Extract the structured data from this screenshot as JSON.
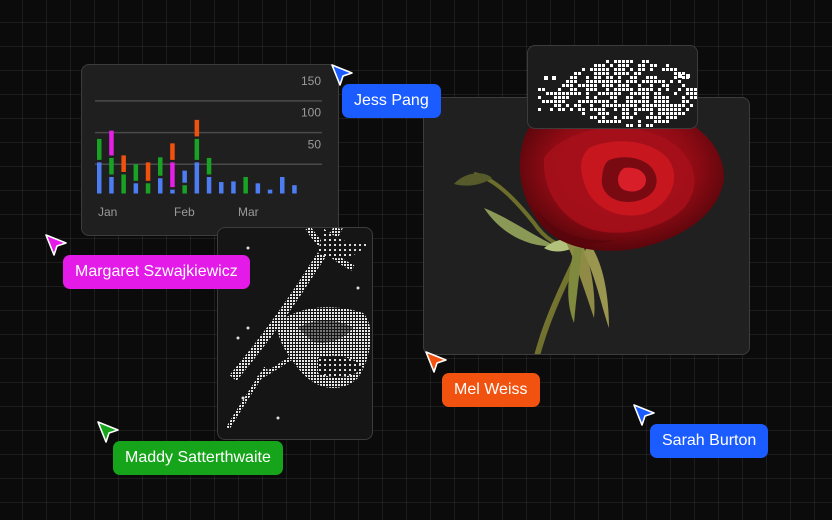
{
  "collaborators": [
    {
      "name": "Jess Pang",
      "color": "#1a5cff"
    },
    {
      "name": "Margaret Szwajkiewicz",
      "color": "#e31ae8"
    },
    {
      "name": "Mel Weiss",
      "color": "#f2520f"
    },
    {
      "name": "Maddy Satterthwaite",
      "color": "#16a41b"
    },
    {
      "name": "Sarah Burton",
      "color": "#1a5cff"
    }
  ],
  "chart_data": {
    "type": "bar",
    "categories": [
      "Jan",
      "Feb",
      "Mar"
    ],
    "y_ticks": [
      150,
      100,
      50
    ],
    "ylim": [
      0,
      175
    ],
    "colors": {
      "blue": "#4d7df2",
      "green": "#19a325",
      "red": "#f0520e",
      "magenta": "#e61ee8"
    },
    "groups": [
      [
        {
          "color": "blue",
          "value": 53
        },
        {
          "color": "green",
          "value": 37
        }
      ],
      [
        {
          "color": "blue",
          "value": 30
        },
        {
          "color": "green",
          "value": 30
        },
        {
          "color": "magenta",
          "value": 43
        }
      ],
      [
        {
          "color": "green",
          "value": 34
        },
        {
          "color": "red",
          "value": 30
        }
      ],
      [
        {
          "color": "blue",
          "value": 20
        },
        {
          "color": "green",
          "value": 30
        }
      ],
      [
        {
          "color": "green",
          "value": 20
        },
        {
          "color": "red",
          "value": 33
        }
      ],
      [
        {
          "color": "blue",
          "value": 28
        },
        {
          "color": "green",
          "value": 33
        }
      ],
      [
        {
          "color": "blue",
          "value": 10
        },
        {
          "color": "magenta",
          "value": 43
        },
        {
          "color": "red",
          "value": 30
        }
      ],
      [
        {
          "color": "green",
          "value": 17
        },
        {
          "color": "blue",
          "value": 23
        }
      ],
      [
        {
          "color": "blue",
          "value": 53
        },
        {
          "color": "green",
          "value": 37
        },
        {
          "color": "red",
          "value": 30
        }
      ],
      [
        {
          "color": "blue",
          "value": 30
        },
        {
          "color": "green",
          "value": 30
        }
      ],
      [
        {
          "color": "blue",
          "value": 22
        }
      ],
      [
        {
          "color": "blue",
          "value": 23
        }
      ],
      [
        {
          "color": "green",
          "value": 30
        }
      ],
      [
        {
          "color": "blue",
          "value": 20
        }
      ],
      [
        {
          "color": "blue",
          "value": 10
        }
      ],
      [
        {
          "color": "blue",
          "value": 30
        }
      ],
      [
        {
          "color": "blue",
          "value": 17
        }
      ]
    ]
  }
}
